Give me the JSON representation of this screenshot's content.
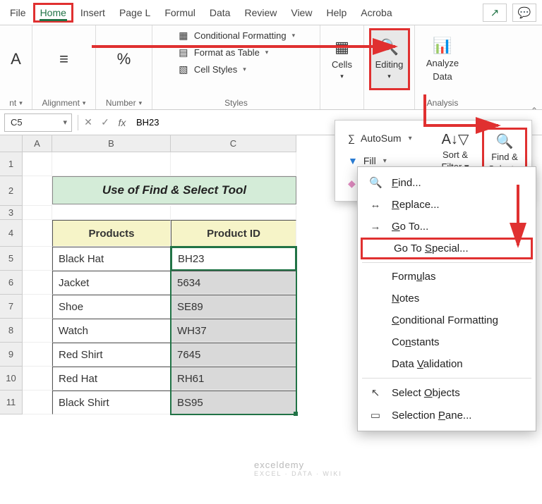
{
  "tabs": {
    "file": "File",
    "home": "Home",
    "insert": "Insert",
    "pagel": "Page L",
    "formul": "Formul",
    "data": "Data",
    "review": "Review",
    "view": "View",
    "help": "Help",
    "acrobat": "Acroba"
  },
  "ribbon": {
    "font_group": "nt",
    "alignment": "Alignment",
    "number": "Number",
    "styles": "Styles",
    "cond_fmt": "Conditional Formatting",
    "as_table": "Format as Table",
    "cell_styles": "Cell Styles",
    "cells": "Cells",
    "editing": "Editing",
    "analyze": "Analyze",
    "analyze2": "Data",
    "analysis": "Analysis"
  },
  "fly": {
    "autosum": "AutoSum",
    "fill": "Fill",
    "clear": "Clear",
    "sortfilter1": "Sort &",
    "sortfilter2": "Filter",
    "findselect1": "Find &",
    "findselect2": "Select"
  },
  "menu": {
    "find": "Find...",
    "replace": "Replace...",
    "goto": "Go To...",
    "gotospecial": "Go To Special...",
    "formulas": "Formulas",
    "notes": "Notes",
    "condfmt": "Conditional Formatting",
    "constants": "Constants",
    "dataval": "Data Validation",
    "selectobj": "Select Objects",
    "selpane": "Selection Pane..."
  },
  "namebox": "C5",
  "formula": "BH23",
  "cols": {
    "A": "A",
    "B": "B",
    "C": "C"
  },
  "title": "Use of Find & Select Tool",
  "headers": {
    "b": "Products",
    "c": "Product ID"
  },
  "data": [
    {
      "b": "Black Hat",
      "c": "BH23"
    },
    {
      "b": "Jacket",
      "c": "5634"
    },
    {
      "b": "Shoe",
      "c": "SE89"
    },
    {
      "b": "Watch",
      "c": "WH37"
    },
    {
      "b": "Red Shirt",
      "c": "7645"
    },
    {
      "b": "Red Hat",
      "c": "RH61"
    },
    {
      "b": "Black Shirt",
      "c": "BS95"
    }
  ],
  "watermark": "exceldemy",
  "watermark2": "EXCEL · DATA · WIKI"
}
